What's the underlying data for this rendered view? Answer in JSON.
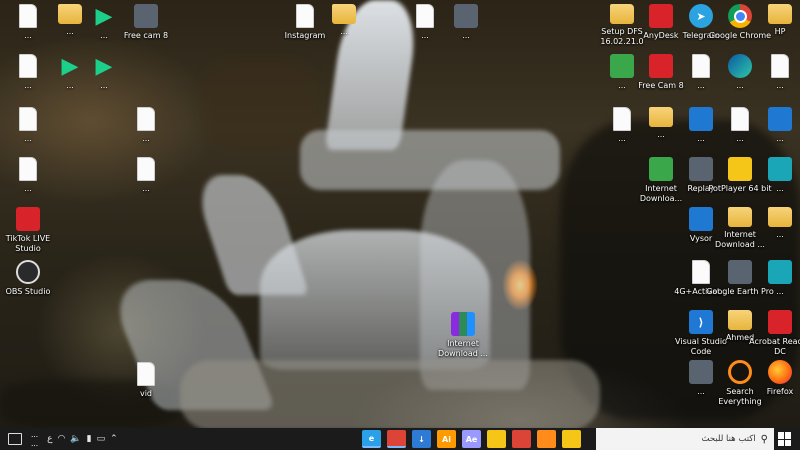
{
  "desktop_icons": {
    "c0": [
      {
        "label": "...",
        "kind": "doc"
      },
      {
        "label": "...",
        "kind": "doc"
      },
      {
        "label": "...",
        "kind": "doc"
      },
      {
        "label": "...",
        "kind": "doc"
      },
      {
        "label": "TikTok LIVE Studio",
        "kind": "red"
      },
      {
        "label": "OBS Studio",
        "kind": "obs"
      }
    ],
    "c1": [
      {
        "label": "...",
        "kind": "folder"
      },
      {
        "label": "...",
        "kind": "mp3"
      }
    ],
    "c2": [
      {
        "label": "...",
        "kind": "mp3"
      },
      {
        "label": "...",
        "kind": "mp3"
      }
    ],
    "c3": [
      {
        "label": "Free cam 8",
        "kind": "gray"
      },
      {
        "label": "...",
        "kind": "doc"
      },
      {
        "label": "...",
        "kind": "doc"
      }
    ],
    "c4": [
      {
        "label": "Instagram",
        "kind": "doc"
      }
    ],
    "c5": [
      {
        "label": "...",
        "kind": "folder"
      }
    ],
    "c6": [
      {
        "label": "...",
        "kind": "doc"
      }
    ],
    "c7": [
      {
        "label": "...",
        "kind": "gray"
      }
    ],
    "c8": [
      {
        "label": "Setup DFS 16.02.21.0",
        "kind": "folder"
      },
      {
        "label": "...",
        "kind": "green"
      },
      {
        "label": "...",
        "kind": "doc"
      }
    ],
    "c9": [
      {
        "label": "AnyDesk",
        "kind": "red"
      },
      {
        "label": "Free Cam 8",
        "kind": "red"
      },
      {
        "label": "...",
        "kind": "folder"
      }
    ],
    "c10": [
      {
        "label": "Telegram",
        "kind": "tg"
      },
      {
        "label": "...",
        "kind": "doc"
      },
      {
        "label": "...",
        "kind": "blue"
      },
      {
        "label": "Replay",
        "kind": "gray"
      },
      {
        "label": "Vysor",
        "kind": "blue"
      },
      {
        "label": "4G+Activat...",
        "kind": "doc"
      },
      {
        "label": "Visual Studio Code",
        "kind": "vs"
      },
      {
        "label": "...",
        "kind": "gray"
      }
    ],
    "c11": [
      {
        "label": "Google Chrome",
        "kind": "chrome"
      },
      {
        "label": "...",
        "kind": "edge"
      },
      {
        "label": "...",
        "kind": "doc"
      },
      {
        "label": "PotPlayer 64 bit",
        "kind": "yellow"
      },
      {
        "label": "Internet Download ...",
        "kind": "folder"
      },
      {
        "label": "Google Earth Pro",
        "kind": "gray"
      },
      {
        "label": "Ahmed",
        "kind": "folder"
      },
      {
        "label": "Search Everything",
        "kind": "ring"
      }
    ],
    "c12": [
      {
        "label": "HP",
        "kind": "folder"
      },
      {
        "label": "...",
        "kind": "doc"
      },
      {
        "label": "...",
        "kind": "blue"
      },
      {
        "label": "...",
        "kind": "teal"
      },
      {
        "label": "...",
        "kind": "folder"
      },
      {
        "label": "...",
        "kind": "teal"
      },
      {
        "label": "Acrobat Reader DC",
        "kind": "red"
      },
      {
        "label": "Firefox",
        "kind": "ff"
      }
    ],
    "misc": {
      "internet_download_left": {
        "label": "Internet Downloa...",
        "kind": "rar"
      },
      "internet_download_mid": {
        "label": "Internet Download ...",
        "kind": "rar"
      },
      "vid": {
        "label": "vid",
        "kind": "doc"
      },
      "doc_mid": {
        "label": "...",
        "kind": "doc"
      },
      "internet_downloa_green": {
        "label": "Internet Downloa...",
        "kind": "green"
      }
    }
  },
  "taskbar": {
    "clock_time": "...",
    "clock_date": "...",
    "search_placeholder": "اكتب هنا للبحث",
    "pinned": [
      {
        "name": "edge",
        "label": "e",
        "color": "#2aa0e8"
      },
      {
        "name": "chrome",
        "label": "",
        "color": "#db4437"
      },
      {
        "name": "download",
        "label": "↓",
        "color": "#2e7bd6"
      },
      {
        "name": "illustrator",
        "label": "Ai",
        "color": "#ff9a00"
      },
      {
        "name": "after-effects",
        "label": "Ae",
        "color": "#9999ff"
      },
      {
        "name": "sticky-notes",
        "label": "",
        "color": "#f5c518"
      },
      {
        "name": "chrome-2",
        "label": "",
        "color": "#db4437"
      },
      {
        "name": "search-everything",
        "label": "",
        "color": "#ff8c1a"
      },
      {
        "name": "explorer",
        "label": "",
        "color": "#f5c518"
      }
    ]
  }
}
